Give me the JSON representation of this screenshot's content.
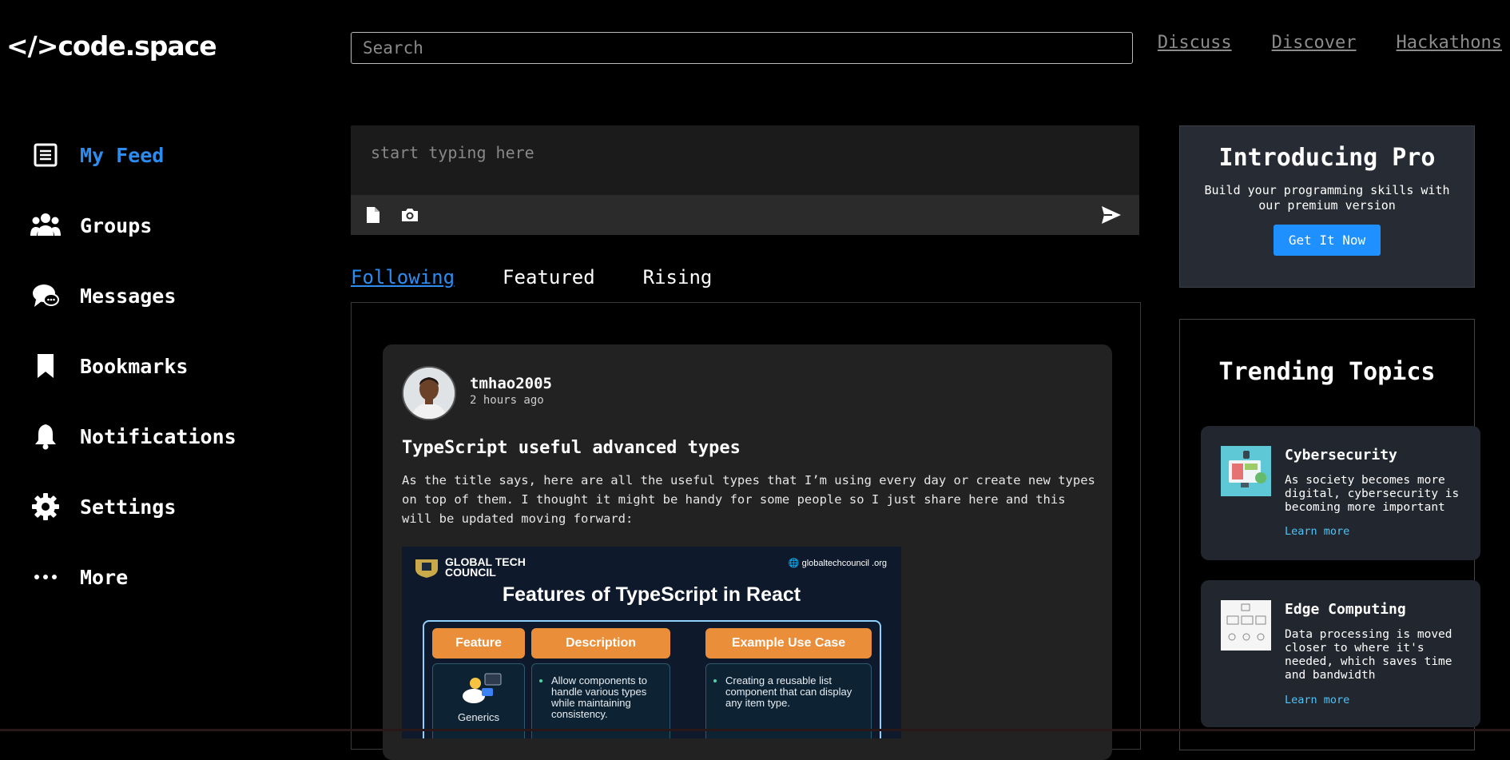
{
  "brand": {
    "logo_text": "</>code.space"
  },
  "search": {
    "placeholder": "Search"
  },
  "topnav": {
    "items": [
      "Discuss",
      "Discover",
      "Hackathons"
    ]
  },
  "sidebar": {
    "items": [
      {
        "label": "My Feed",
        "icon": "list-icon",
        "active": true
      },
      {
        "label": "Groups",
        "icon": "users-icon"
      },
      {
        "label": "Messages",
        "icon": "chat-icon"
      },
      {
        "label": "Bookmarks",
        "icon": "bookmark-icon"
      },
      {
        "label": "Notifications",
        "icon": "bell-icon"
      },
      {
        "label": "Settings",
        "icon": "gear-icon"
      },
      {
        "label": "More",
        "icon": "ellipsis-icon"
      }
    ],
    "active_color": "#2d8cf0"
  },
  "composer": {
    "placeholder": "start typing here"
  },
  "tabs": [
    {
      "label": "Following",
      "active": true
    },
    {
      "label": "Featured"
    },
    {
      "label": "Rising"
    }
  ],
  "post": {
    "author": "tmhao2005",
    "time": "2 hours ago",
    "title": "TypeScript useful advanced types",
    "body": "As the title says, here are all the useful types that I’m using every day or create new types on top of them. I thought it might be handy for some people so I just share here and this will be updated moving forward:",
    "image": {
      "brand": "GLOBAL TECH COUNCIL",
      "brand_line1": "GLOBAL TECH",
      "brand_line2": "COUNCIL",
      "site": "globaltechcouncil .org",
      "title": "Features of TypeScript in React",
      "headers": [
        "Feature",
        "Description",
        "Example Use Case"
      ],
      "row": {
        "feature": "Generics",
        "description": "Allow components to handle various types while maintaining consistency.",
        "example": "Creating a reusable list component that can display any item type."
      }
    }
  },
  "promo": {
    "title": "Introducing Pro",
    "text": "Build your programming skills with our premium version",
    "button": "Get It Now",
    "accent": "#1e90ff"
  },
  "trending": {
    "title": "Trending Topics",
    "topics": [
      {
        "name": "Cybersecurity",
        "desc": "As society becomes more digital, cybersecurity is becoming more important",
        "link": "Learn more"
      },
      {
        "name": "Edge Computing",
        "desc": "Data processing is moved closer to where it's needed, which saves time and bandwidth",
        "link": "Learn more"
      }
    ]
  }
}
